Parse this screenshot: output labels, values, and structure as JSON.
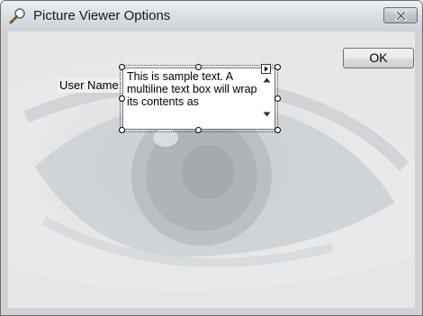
{
  "window": {
    "title": "Picture Viewer Options"
  },
  "form": {
    "ok_label": "OK",
    "user_name_label": "User Name:",
    "textbox_value": "This is sample text. A multiline text box will wrap its contents as"
  },
  "icons": {
    "title_icon": "magnifier-icon",
    "close_icon": "close-icon",
    "smart_tag_icon": "smart-tag-arrow-icon",
    "scroll_up_icon": "scroll-up-arrow-icon",
    "scroll_down_icon": "scroll-down-arrow-icon"
  }
}
